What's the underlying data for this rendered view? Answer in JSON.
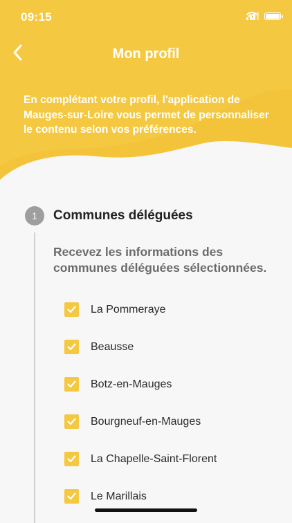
{
  "status_bar": {
    "time": "09:15",
    "signal_icon": "cellular-signal-icon",
    "wifi_icon": "wifi-icon",
    "battery_icon": "battery-icon"
  },
  "header": {
    "title": "Mon profil",
    "back_icon": "chevron-left-icon",
    "intro": "En complétant votre profil, l'application de Mauges-sur-Loire vous permet de personnaliser le contenu selon vos préférences.",
    "colors": {
      "primary": "#f5c842",
      "secondary": "#f3c33a"
    }
  },
  "section": {
    "step": "1",
    "title": "Communes déléguées",
    "description": "Recevez les informations des communes déléguées sélectionnées.",
    "options": [
      {
        "label": "La Pommeraye",
        "checked": true
      },
      {
        "label": "Beausse",
        "checked": true
      },
      {
        "label": "Botz-en-Mauges",
        "checked": true
      },
      {
        "label": "Bourgneuf-en-Mauges",
        "checked": true
      },
      {
        "label": "La Chapelle-Saint-Florent",
        "checked": true
      },
      {
        "label": "Le Marillais",
        "checked": true
      }
    ]
  }
}
